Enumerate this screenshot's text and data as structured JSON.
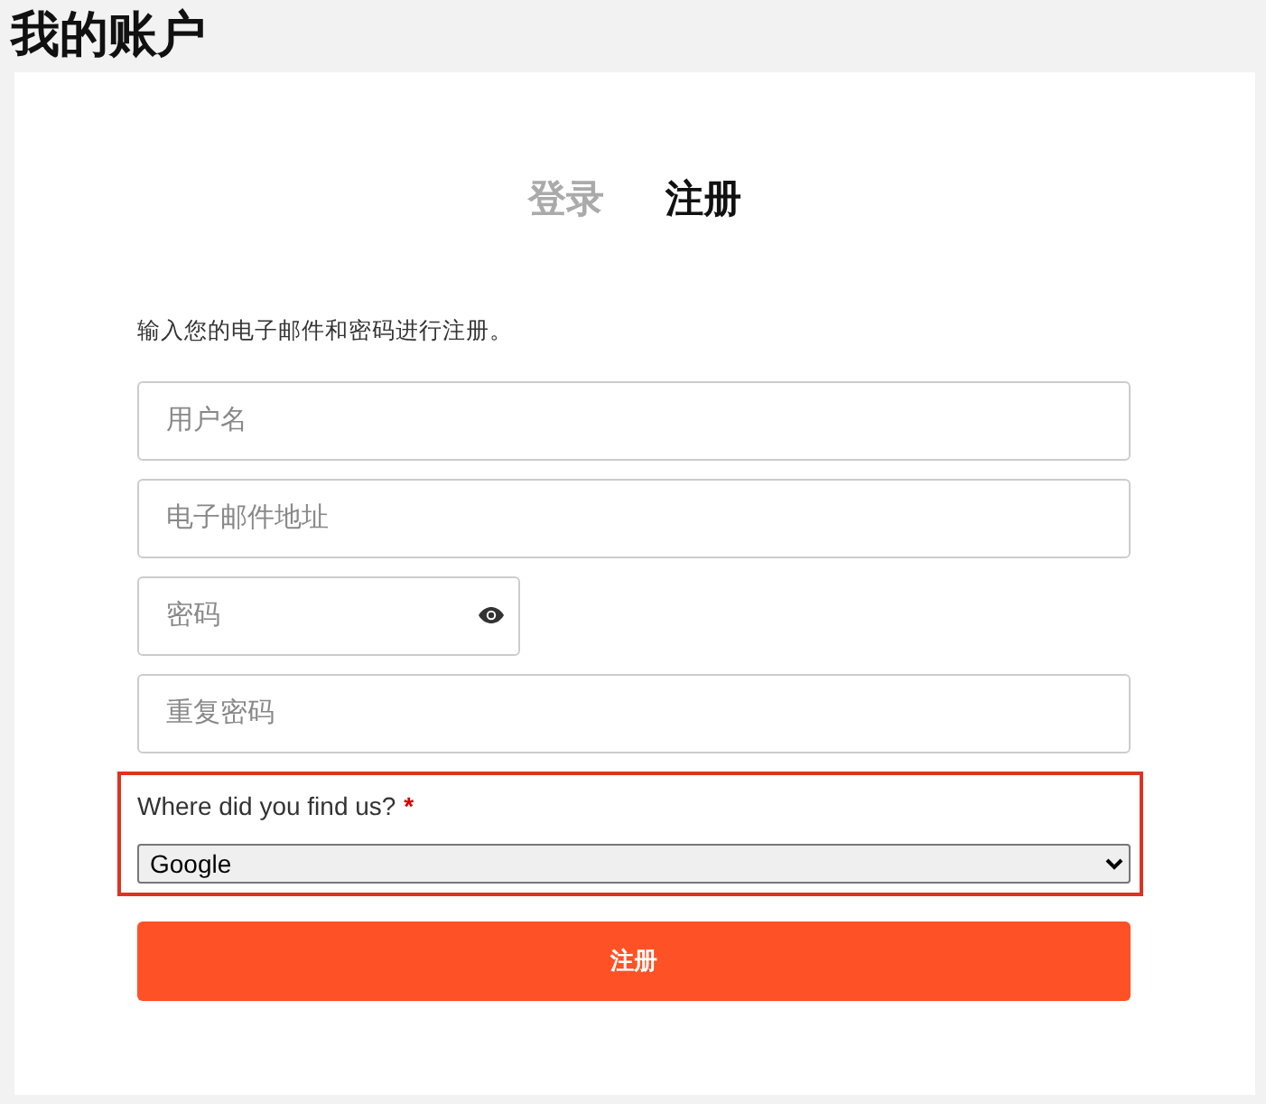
{
  "page_title": "我的账户",
  "tabs": [
    {
      "label": "登录",
      "selected": false
    },
    {
      "label": "注册",
      "selected": true
    }
  ],
  "intro": "输入您的电子邮件和密码进行注册。",
  "fields": [
    {
      "kind": "text",
      "placeholder": "用户名"
    },
    {
      "kind": "text",
      "placeholder": "电子邮件地址"
    },
    {
      "kind": "password",
      "placeholder": "密码"
    },
    {
      "kind": "text",
      "placeholder": "重复密码"
    }
  ],
  "survey": {
    "label": "Where did you find us?",
    "required_mark": "*",
    "value": "Google"
  },
  "submit": "注册"
}
